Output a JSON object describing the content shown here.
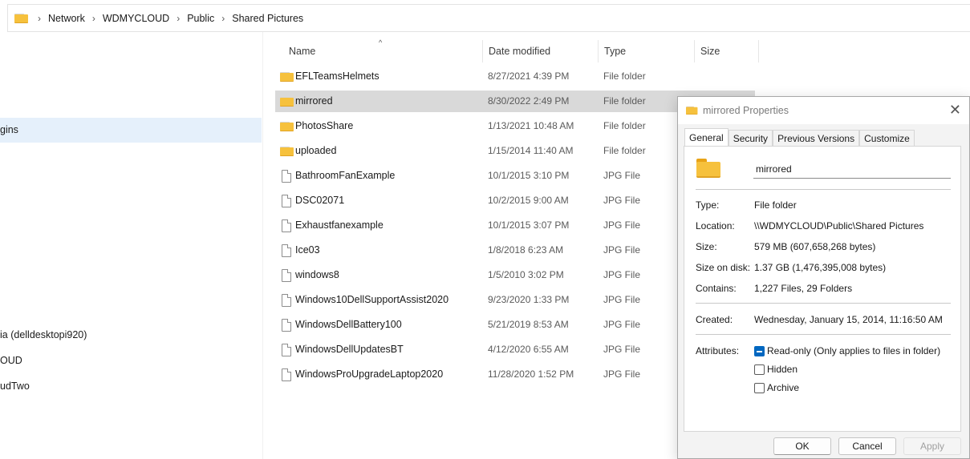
{
  "address_bar": {
    "crumbs": [
      "Network",
      "WDMYCLOUD",
      "Public",
      "Shared Pictures"
    ]
  },
  "nav": {
    "items": [
      {
        "label": "gins",
        "selected": true
      },
      {
        "label": "ia (delldesktopi920)",
        "selected": false
      },
      {
        "label": "OUD",
        "selected": false
      },
      {
        "label": "udTwo",
        "selected": false
      }
    ]
  },
  "list": {
    "columns": {
      "name": "Name",
      "date": "Date modified",
      "type": "Type",
      "size": "Size"
    },
    "sort_indicator": "^",
    "rows": [
      {
        "name": "EFLTeamsHelmets",
        "date": "8/27/2021 4:39 PM",
        "type": "File folder",
        "icon": "folder-icon"
      },
      {
        "name": "mirrored",
        "date": "8/30/2022 2:49 PM",
        "type": "File folder",
        "icon": "folder-icon"
      },
      {
        "name": "PhotosShare",
        "date": "1/13/2021 10:48 AM",
        "type": "File folder",
        "icon": "folder-icon"
      },
      {
        "name": "uploaded",
        "date": "1/15/2014 11:40 AM",
        "type": "File folder",
        "icon": "folder-icon"
      },
      {
        "name": "BathroomFanExample",
        "date": "10/1/2015 3:10 PM",
        "type": "JPG File",
        "icon": "file-icon"
      },
      {
        "name": "DSC02071",
        "date": "10/2/2015 9:00 AM",
        "type": "JPG File",
        "icon": "file-icon"
      },
      {
        "name": "Exhaustfanexample",
        "date": "10/1/2015 3:07 PM",
        "type": "JPG File",
        "icon": "file-icon"
      },
      {
        "name": "Ice03",
        "date": "1/8/2018 6:23 AM",
        "type": "JPG File",
        "icon": "file-icon"
      },
      {
        "name": "windows8",
        "date": "1/5/2010 3:02 PM",
        "type": "JPG File",
        "icon": "file-icon"
      },
      {
        "name": "Windows10DellSupportAssist2020",
        "date": "9/23/2020 1:33 PM",
        "type": "JPG File",
        "icon": "file-icon"
      },
      {
        "name": "WindowsDellBattery100",
        "date": "5/21/2019 8:53 AM",
        "type": "JPG File",
        "icon": "file-icon"
      },
      {
        "name": "WindowsDellUpdatesBT",
        "date": "4/12/2020 6:55 AM",
        "type": "JPG File",
        "icon": "file-icon"
      },
      {
        "name": "WindowsProUpgradeLaptop2020",
        "date": "11/28/2020 1:52 PM",
        "type": "JPG File",
        "icon": "file-icon"
      }
    ]
  },
  "dialog": {
    "title": "mirrored Properties",
    "close_glyph": "✕",
    "tabs": [
      "General",
      "Security",
      "Previous Versions",
      "Customize"
    ],
    "active_tab": "General",
    "name_value": "mirrored",
    "labels": {
      "type": "Type:",
      "location": "Location:",
      "size": "Size:",
      "size_on_disk": "Size on disk:",
      "contains": "Contains:",
      "created": "Created:",
      "attributes": "Attributes:"
    },
    "values": {
      "type": "File folder",
      "location": "\\\\WDMYCLOUD\\Public\\Shared Pictures",
      "size": "579 MB (607,658,268 bytes)",
      "size_on_disk": "1.37 GB (1,476,395,008 bytes)",
      "contains": "1,227 Files, 29 Folders",
      "created": "Wednesday, January 15, 2014, 11:16:50 AM"
    },
    "attributes": {
      "readonly": "Read-only (Only applies to files in folder)",
      "hidden": "Hidden",
      "archive": "Archive"
    },
    "buttons": {
      "ok": "OK",
      "cancel": "Cancel",
      "apply": "Apply"
    }
  }
}
